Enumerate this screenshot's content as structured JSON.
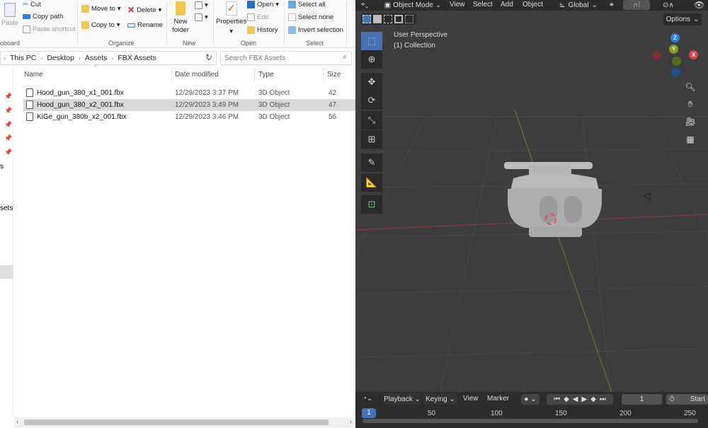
{
  "explorer": {
    "ribbon": {
      "clipboard": {
        "paste": "Paste",
        "cut": "Cut",
        "copy_path": "Copy path",
        "paste_shortcut": "Paste shortcut",
        "group": "oboard"
      },
      "organize": {
        "move_to": "Move to",
        "copy_to": "Copy to",
        "delete": "Delete",
        "rename": "Rename",
        "group": "Organize"
      },
      "new": {
        "new_folder": "New folder",
        "group": "New"
      },
      "open": {
        "properties": "Properties",
        "open": "Open",
        "edit": "Edit",
        "history": "History",
        "group": "Open"
      },
      "select": {
        "select_all": "Select all",
        "select_none": "Select none",
        "invert_selection": "Invert selection",
        "group": "Select"
      }
    },
    "breadcrumb": [
      "This PC",
      "Desktop",
      "Assets",
      "FBX Assets"
    ],
    "search_placeholder": "Search FBX Assets",
    "columns": {
      "name": "Name",
      "date": "Date modified",
      "type": "Type",
      "size": "Size"
    },
    "files": [
      {
        "name": "Hood_gun_380_x1_001.fbx",
        "date": "12/29/2023 3:37 PM",
        "type": "3D Object",
        "size": "42"
      },
      {
        "name": "Hood_gun_380_x2_001.fbx",
        "date": "12/29/2023 3:49 PM",
        "type": "3D Object",
        "size": "47",
        "selected": true
      },
      {
        "name": "KiGe_gun_380b_x2_001.fbx",
        "date": "12/29/2023 3:46 PM",
        "type": "3D Object",
        "size": "56"
      }
    ],
    "nav_fragments": [
      "s",
      "sets"
    ]
  },
  "blender": {
    "header": {
      "mode": "Object Mode",
      "menus": [
        "View",
        "Select",
        "Add",
        "Object"
      ],
      "orientation": "Global",
      "options": "Options"
    },
    "viewport": {
      "perspective": "User Perspective",
      "collection": "(1) Collection"
    },
    "gizmo": {
      "z": "Z",
      "y": "Y",
      "x": "X"
    },
    "timeline": {
      "menus": [
        "Playback",
        "Keying",
        "View",
        "Marker"
      ],
      "current_frame": "1",
      "start_label": "Start",
      "ticks": [
        "50",
        "100",
        "150",
        "200",
        "250"
      ],
      "frame_badge": "1"
    }
  },
  "colors": {
    "blender_bg": "#3d3d3d",
    "accent_blue": "#4772b3",
    "x_axis": "#e0404a",
    "y_axis": "#7ea02c",
    "z_axis": "#2f7fe0"
  }
}
